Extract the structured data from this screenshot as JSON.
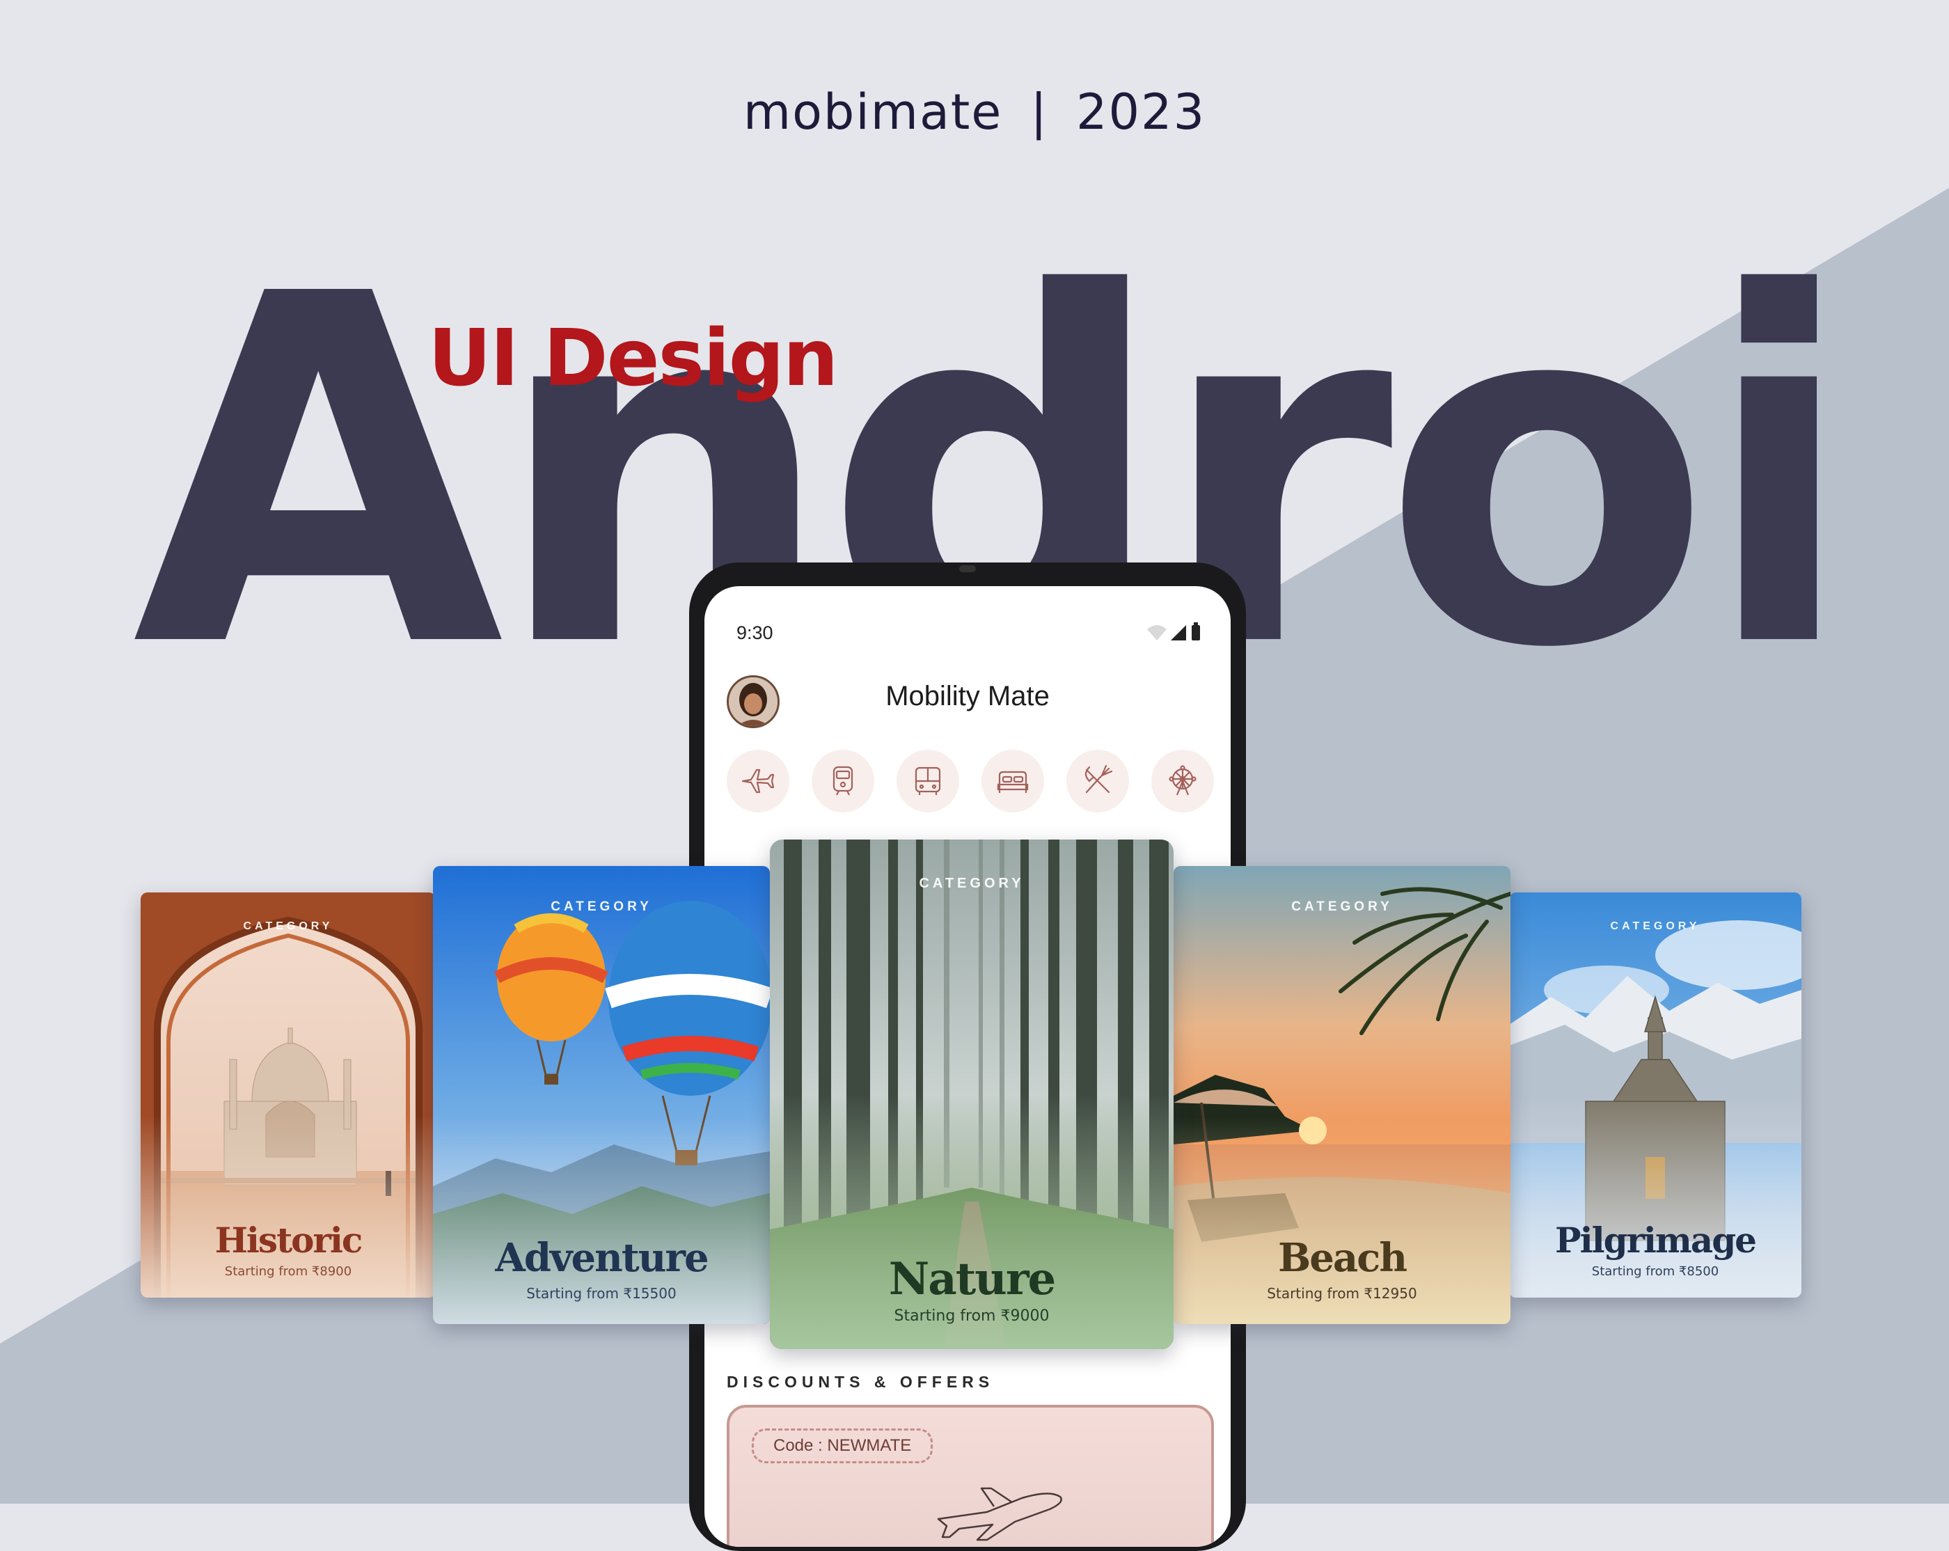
{
  "header": {
    "brand": "mobimate",
    "separator": "|",
    "year": "2023",
    "subtitle": "UI Design",
    "hero": "Android"
  },
  "colors": {
    "background_light": "#e4e6eb",
    "background_dark": "#b8c0cc",
    "hero_text": "#3b3a51",
    "subtitle_red": "#b3161b",
    "accent_icon": "#a3615a"
  },
  "phone": {
    "status_time": "9:30",
    "status_icons": [
      "wifi-icon",
      "signal-icon",
      "battery-icon"
    ],
    "app_title": "Mobility Mate",
    "categories": [
      {
        "icon": "airplane-icon"
      },
      {
        "icon": "train-icon"
      },
      {
        "icon": "bus-icon"
      },
      {
        "icon": "bed-icon"
      },
      {
        "icon": "restaurant-icon"
      },
      {
        "icon": "ferris-wheel-icon"
      }
    ],
    "offers_title": "DISCOUNTS & OFFERS",
    "promo_code": "Code : NEWMATE"
  },
  "cards": [
    {
      "category": "CATEGORY",
      "name": "Historic",
      "price": "Starting from ₹8900"
    },
    {
      "category": "CATEGORY",
      "name": "Adventure",
      "price": "Starting from ₹15500"
    },
    {
      "category": "CATEGORY",
      "name": "Nature",
      "price": "Starting from ₹9000"
    },
    {
      "category": "CATEGORY",
      "name": "Beach",
      "price": "Starting from ₹12950"
    },
    {
      "category": "CATEGORY",
      "name": "Pilgrimage",
      "price": "Starting from ₹8500"
    }
  ]
}
